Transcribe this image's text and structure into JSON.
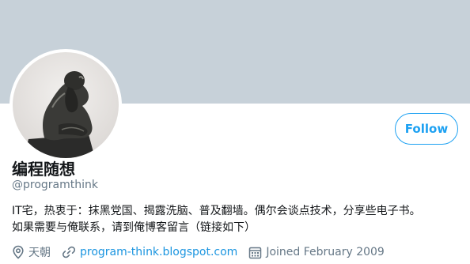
{
  "profile": {
    "display_name": "编程随想",
    "handle": "@programthink",
    "bio_line1": "IT宅，热衷于：抹黑党国、揭露洗脑、普及翻墙。偶尔会谈点技术，分享些电子书。",
    "bio_line2": "如果需要与俺联系，请到俺博客留言（链接如下）",
    "location": "天朝",
    "website": "program-think.blogspot.com",
    "joined": "Joined February 2009"
  },
  "actions": {
    "follow_label": "Follow"
  },
  "icons": {
    "location": "location-pin-icon",
    "website": "link-icon",
    "joined": "calendar-icon"
  },
  "colors": {
    "accent": "#1da1f2",
    "banner": "#c7d1d9",
    "secondary_text": "#657786",
    "link": "#1b95e0"
  }
}
